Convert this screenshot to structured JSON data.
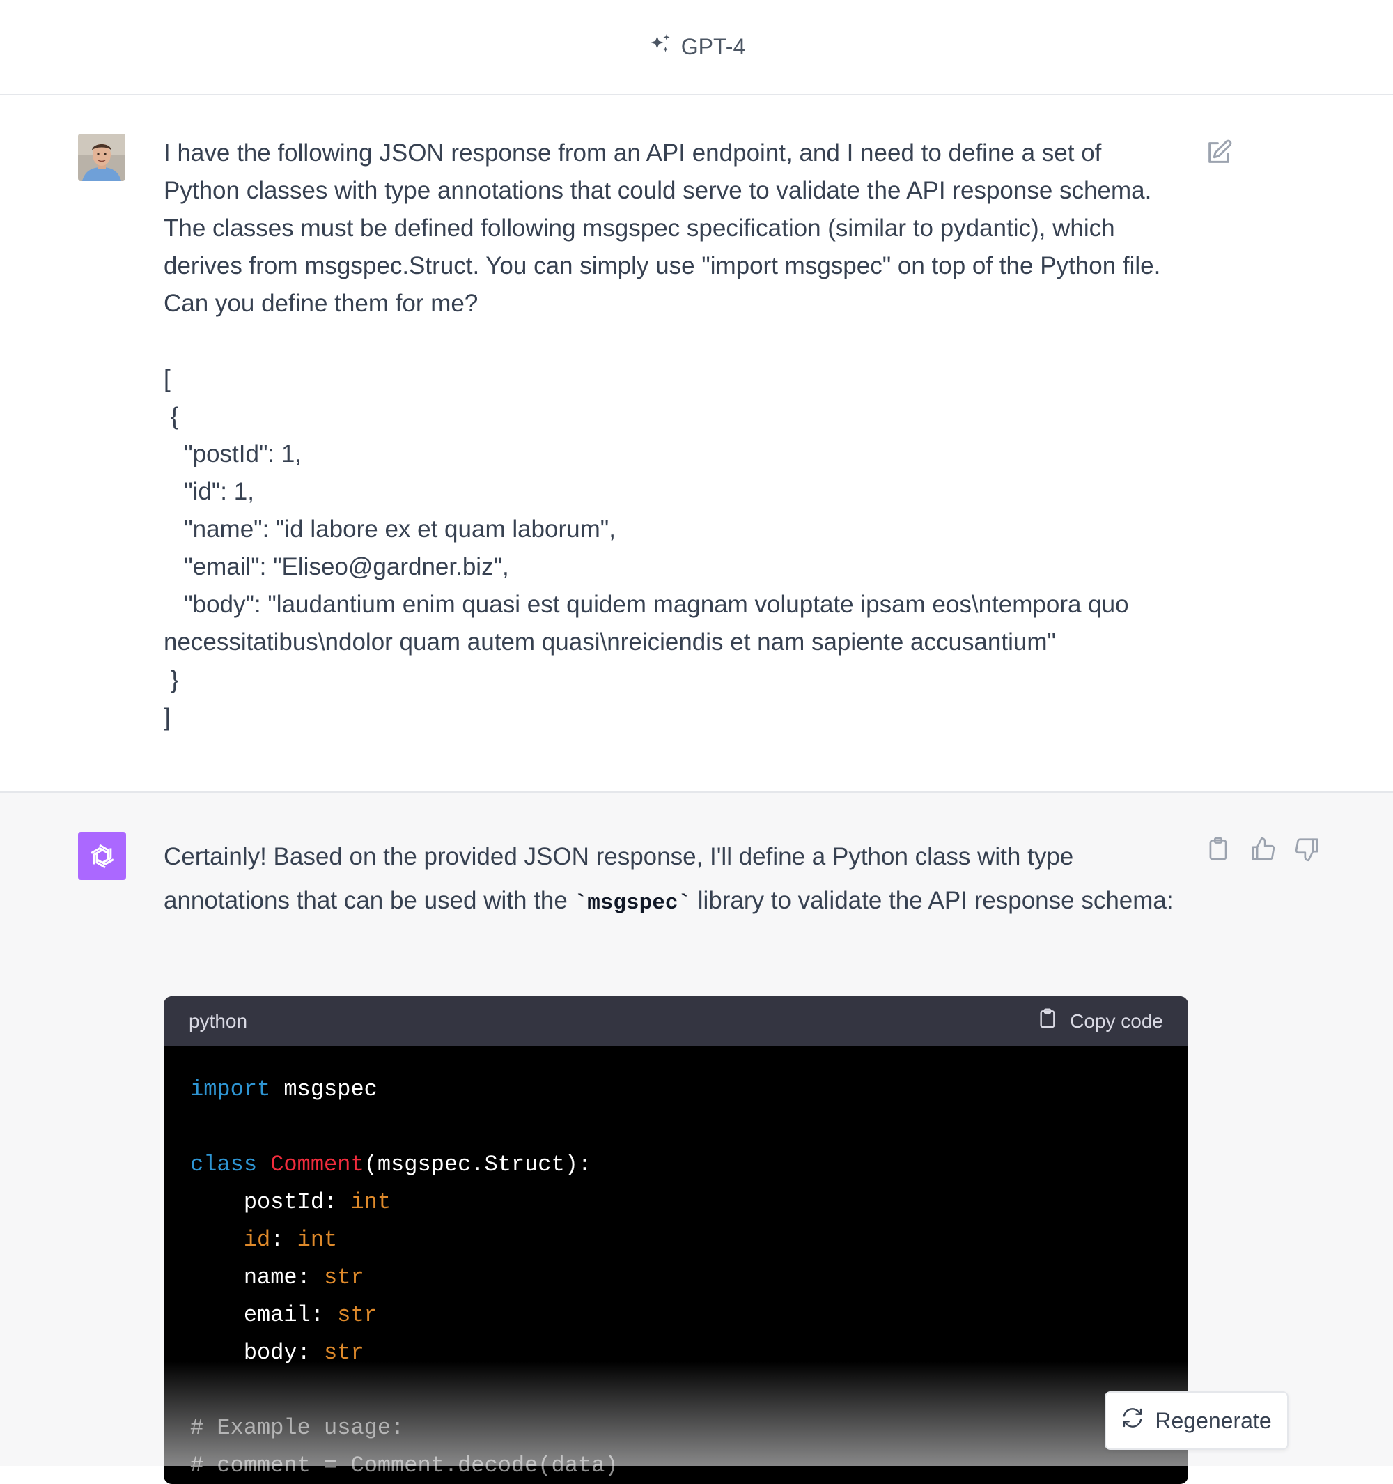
{
  "header": {
    "model_name": "GPT-4",
    "model_icon": "sparkles-icon"
  },
  "user_message": {
    "avatar": "user-photo-avatar",
    "text": "I have the following JSON response from an API endpoint, and I need to define a set of\nPython classes with type annotations that could serve to validate the API response schema.\nThe classes must be defined following msgspec specification (similar to pydantic), which\nderives from msgspec.Struct. You can simply use \"import msgspec\" on top of the Python file.\nCan you define them for me?\n\n[\n {\n   \"postId\": 1,\n   \"id\": 1,\n   \"name\": \"id labore ex et quam laborum\",\n   \"email\": \"Eliseo@gardner.biz\",\n   \"body\": \"laudantium enim quasi est quidem magnam voluptate ipsam eos\\ntempora quo\nnecessitatibus\\ndolor quam autem quasi\\nreiciendis et nam sapiente accusantium\"\n }\n]",
    "edit_icon": "edit-icon"
  },
  "assistant_message": {
    "avatar": "openai-logo-icon",
    "text_before": "Certainly! Based on the provided JSON response, I'll define a Python class with type annotations that can be used with the ",
    "inline_code": "`msgspec`",
    "text_after": " library to validate the API response schema:",
    "actions": [
      "copy-icon",
      "thumbs-up-icon",
      "thumbs-down-icon"
    ]
  },
  "code_block": {
    "language": "python",
    "copy_label": "Copy code",
    "lines": {
      "l1_kw": "import",
      "l1_rest": " msgspec",
      "l3_kw": "class",
      "l3_cls": " Comment",
      "l3_rest": "(msgspec.Struct):",
      "l4_name": "    postId: ",
      "l4_type": "int",
      "l5_name": "    id",
      "l5_colon": ": ",
      "l5_type": "int",
      "l6_name": "    name: ",
      "l6_type": "str",
      "l7_name": "    email: ",
      "l7_type": "str",
      "l8_name": "    body: ",
      "l8_type": "str",
      "l10": "# Example usage:",
      "l11": "# comment = Comment.decode(data)"
    }
  },
  "regenerate": {
    "label": "Regenerate"
  },
  "colors": {
    "keyword": "#2e95d3",
    "class_name": "#f22c3d",
    "type": "#df8a2b",
    "assistant_avatar": "#ab68ff"
  }
}
